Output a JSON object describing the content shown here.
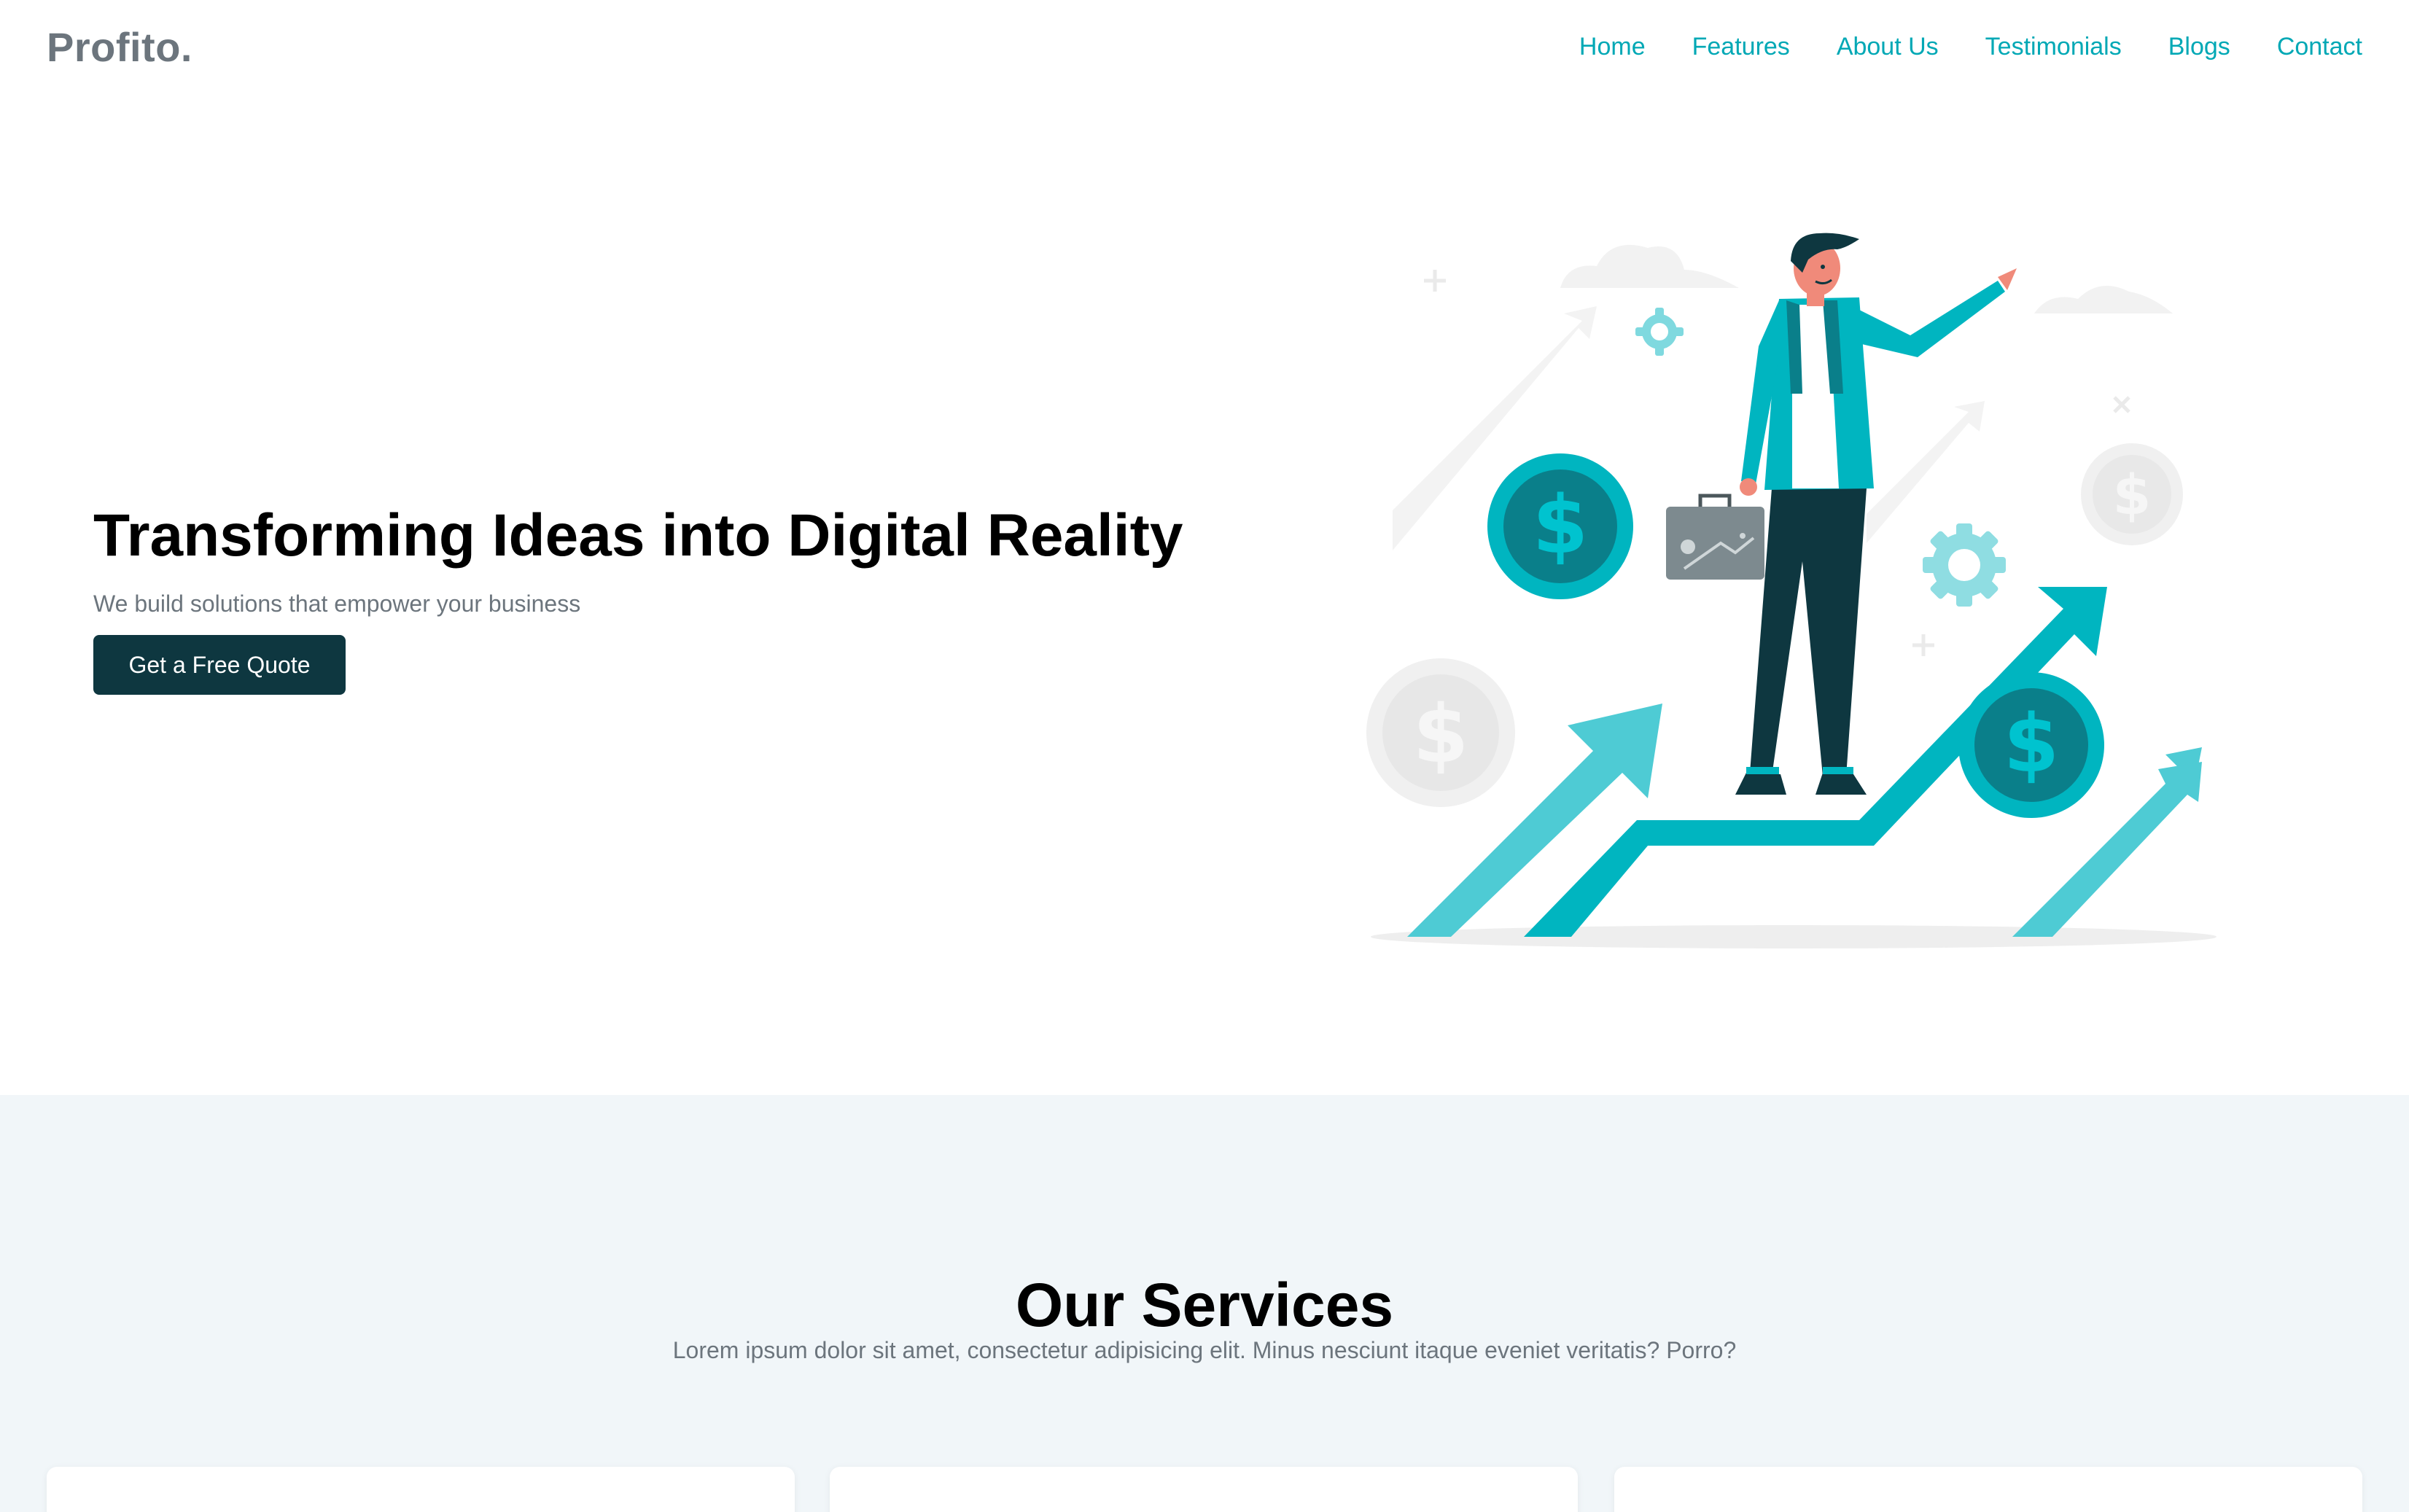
{
  "brand": {
    "name": "Profito."
  },
  "nav": {
    "items": [
      {
        "label": "Home"
      },
      {
        "label": "Features"
      },
      {
        "label": "About Us"
      },
      {
        "label": "Testimonials"
      },
      {
        "label": "Blogs"
      },
      {
        "label": "Contact"
      }
    ]
  },
  "hero": {
    "title": "Transforming Ideas into Digital Reality",
    "subtitle": "We build solutions that empower your business",
    "cta_label": "Get a Free Quote",
    "illustration": {
      "icons": [
        "dollar-coin-icon",
        "gear-icon",
        "arrow-up-icon",
        "briefcase-icon",
        "cloud-icon"
      ]
    }
  },
  "services": {
    "title": "Our Services",
    "subtitle": "Lorem ipsum dolor sit amet, consectetur adipisicing elit. Minus nesciunt itaque eveniet veritatis? Porro?"
  },
  "colors": {
    "accent": "#00a8b5",
    "teal_light": "#4ecbd4",
    "dark": "#0e3740",
    "muted_text": "#6c757d",
    "section_bg": "#f1f6f9"
  }
}
